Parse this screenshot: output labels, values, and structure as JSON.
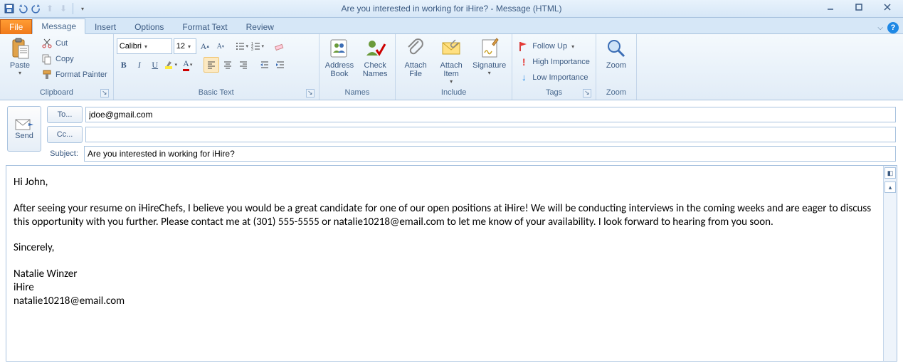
{
  "window": {
    "title": "Are you interested in working for iHire?  -  Message (HTML)"
  },
  "tabs": {
    "file": "File",
    "message": "Message",
    "insert": "Insert",
    "options": "Options",
    "format_text": "Format Text",
    "review": "Review"
  },
  "ribbon": {
    "clipboard": {
      "label": "Clipboard",
      "paste": "Paste",
      "cut": "Cut",
      "copy": "Copy",
      "format_painter": "Format Painter"
    },
    "basictext": {
      "label": "Basic Text",
      "font_name": "Calibri",
      "font_size": "12"
    },
    "names": {
      "label": "Names",
      "address_book": "Address\nBook",
      "check_names": "Check\nNames"
    },
    "include": {
      "label": "Include",
      "attach_file": "Attach\nFile",
      "attach_item": "Attach\nItem",
      "signature": "Signature"
    },
    "tags": {
      "label": "Tags",
      "follow_up": "Follow Up",
      "high_importance": "High Importance",
      "low_importance": "Low Importance"
    },
    "zoom": {
      "label": "Zoom",
      "zoom": "Zoom"
    }
  },
  "compose": {
    "send": "Send",
    "to_label": "To...",
    "to_value": "jdoe@gmail.com",
    "cc_label": "Cc...",
    "cc_value": "",
    "subject_label": "Subject:",
    "subject_value": "Are you interested in working for iHire?"
  },
  "body": {
    "greeting": "Hi John,",
    "p1": "After seeing your resume on iHireChefs, I believe you would be a great candidate for one of our open positions at iHire! We will be conducting interviews in the coming weeks and are eager to discuss this opportunity with you further. Please contact me at (301) 555-5555 or natalie10218@email.com to let me know of your availability. I look forward to hearing from you soon.",
    "closing": "Sincerely,",
    "sig1": "Natalie Winzer",
    "sig2": "iHire",
    "sig3": "natalie10218@email.com"
  }
}
